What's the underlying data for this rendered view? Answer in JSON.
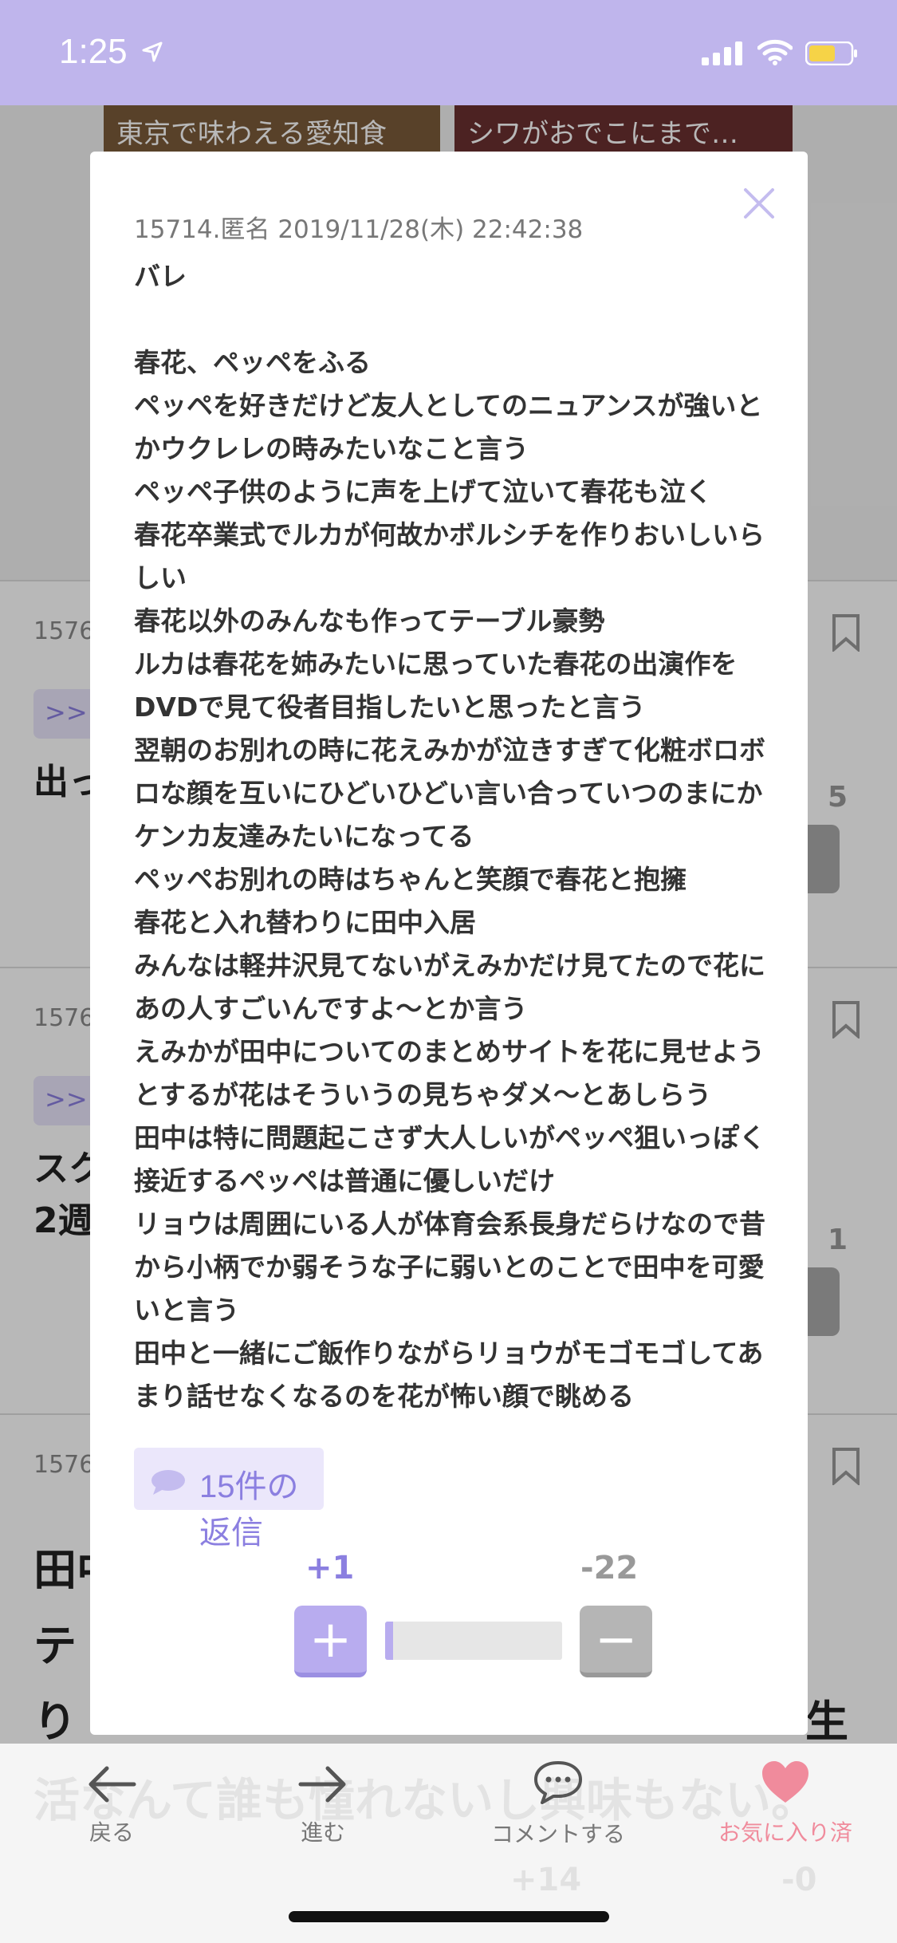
{
  "status_bar": {
    "time": "1:25"
  },
  "background": {
    "thumbs": [
      "東京で味わえる愛知食",
      "シワがおでこにまで…"
    ],
    "cards": [
      {
        "num": "1576",
        "tag": ">>",
        "text": "出っ",
        "count": "5"
      },
      {
        "num": "1576",
        "tag": ">>",
        "text": "スク",
        "text2": "2週",
        "count": "1"
      },
      {
        "num": "1576",
        "text": "田中",
        "text2": "テ",
        "text3": "り",
        "text_right": "生"
      }
    ],
    "nav_ghost_text": "活なんて誰も憧れないし興味もない。",
    "nav_ghost_plus": "+14",
    "nav_ghost_minus": "-0"
  },
  "modal": {
    "meta": "15714.匿名 2019/11/28(木) 22:42:38",
    "lines": [
      "バレ",
      "",
      "春花、ペッペをふる",
      "ペッペを好きだけど友人としてのニュアンスが強いと",
      "かウクレレの時みたいなこと言う",
      "ペッペ子供のように声を上げて泣いて春花も泣く",
      "春花卒業式でルカが何故かボルシチを作りおいしいら",
      "しい",
      "春花以外のみんなも作ってテーブル豪勢",
      "ルカは春花を姉みたいに思っていた春花の出演作を",
      "DVDで見て役者目指したいと思ったと言う",
      "翌朝のお別れの時に花えみかが泣きすぎて化粧ボロボ",
      "ロな顔を互いにひどいひどい言い合っていつのまにか",
      "ケンカ友達みたいになってる",
      "ペッペお別れの時はちゃんと笑顔で春花と抱擁",
      "春花と入れ替わりに田中入居",
      "みんなは軽井沢見てないがえみかだけ見てたので花に",
      "あの人すごいんですよ〜とか言う",
      "えみかが田中についてのまとめサイトを花に見せよう",
      "とするが花はそういうの見ちゃダメ〜とあしらう",
      "田中は特に問題起こさず大人しいがペッペ狙いっぽく",
      "接近するペッペは普通に優しいだけ",
      "リョウは周囲にいる人が体育会系長身だらけなので昔",
      "から小柄でか弱そうな子に弱いとのことで田中を可愛",
      "いと言う",
      "田中と一緒にご飯作りながらリョウがモゴモゴしてあ",
      "まり話せなくなるのを花が怖い顔で眺める"
    ],
    "reply_label": "15件の返信",
    "plus_count": "+1",
    "minus_count": "-22",
    "plus_glyph": "+",
    "minus_glyph": "−",
    "ratio": 0.043
  },
  "nav": {
    "back": "戻る",
    "forward": "進む",
    "comment": "コメントする",
    "favorite": "お気に入り済"
  },
  "colors": {
    "accent": "#8b7fe0",
    "status_bar": "#bfb5ec",
    "favorite": "#f08b9c"
  }
}
